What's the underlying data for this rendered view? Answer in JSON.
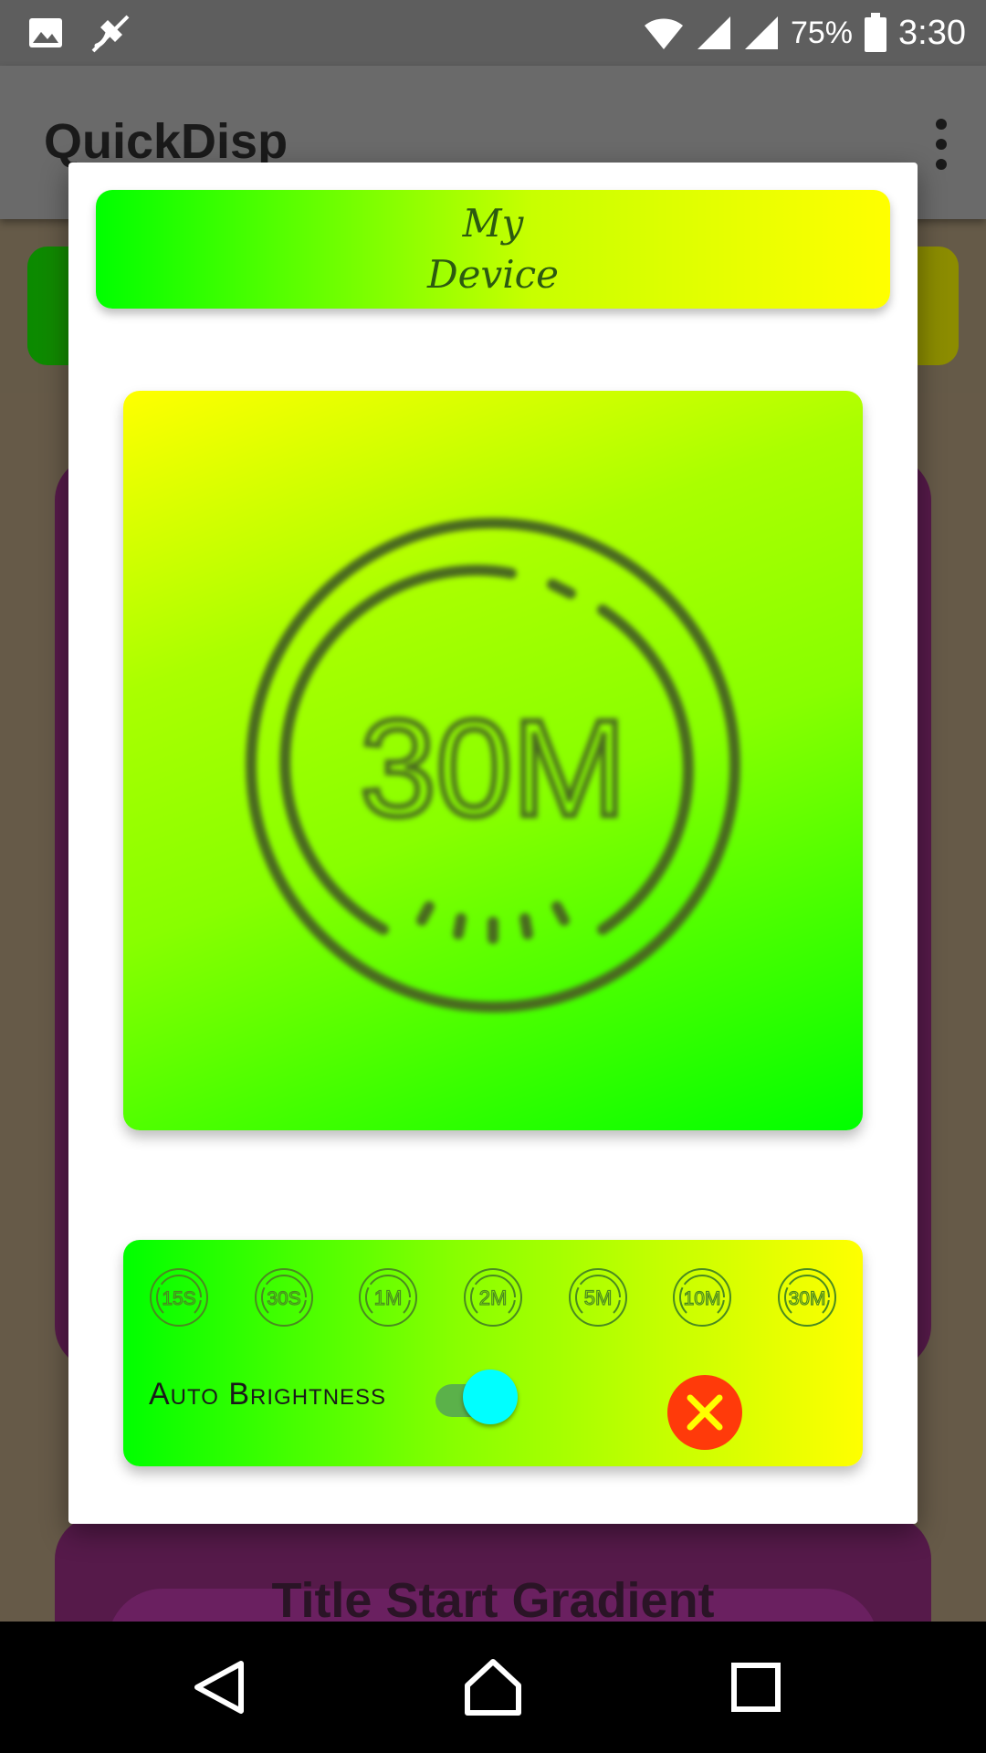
{
  "status_bar": {
    "battery": "75%",
    "time": "3:30",
    "icons": [
      "image-icon",
      "satellite-off-icon",
      "wifi-icon",
      "signal-icon",
      "signal-icon",
      "battery-icon"
    ]
  },
  "app": {
    "title": "QuickDisp",
    "background_card_title": "Title Start Gradient"
  },
  "dialog": {
    "title_line1": "My",
    "title_line2": "Device",
    "preview_icon": "timer-30m-icon",
    "timeouts": [
      {
        "label": "15S",
        "icon": "timer-15s-icon"
      },
      {
        "label": "30S",
        "icon": "timer-30s-icon"
      },
      {
        "label": "1M",
        "icon": "timer-1m-icon"
      },
      {
        "label": "2M",
        "icon": "timer-2m-icon"
      },
      {
        "label": "5M",
        "icon": "timer-5m-icon"
      },
      {
        "label": "10M",
        "icon": "timer-10m-icon"
      },
      {
        "label": "30M",
        "icon": "timer-30m-icon"
      }
    ],
    "auto_brightness_label": "Auto Brightness",
    "auto_brightness_on": true,
    "preview_value": "30M",
    "close_icon": "close-icon"
  },
  "colors": {
    "header_gradient": [
      "#00ff00",
      "#ffff00"
    ],
    "toggle_thumb": "#00ffff",
    "close_button": "#ff3a0a"
  }
}
